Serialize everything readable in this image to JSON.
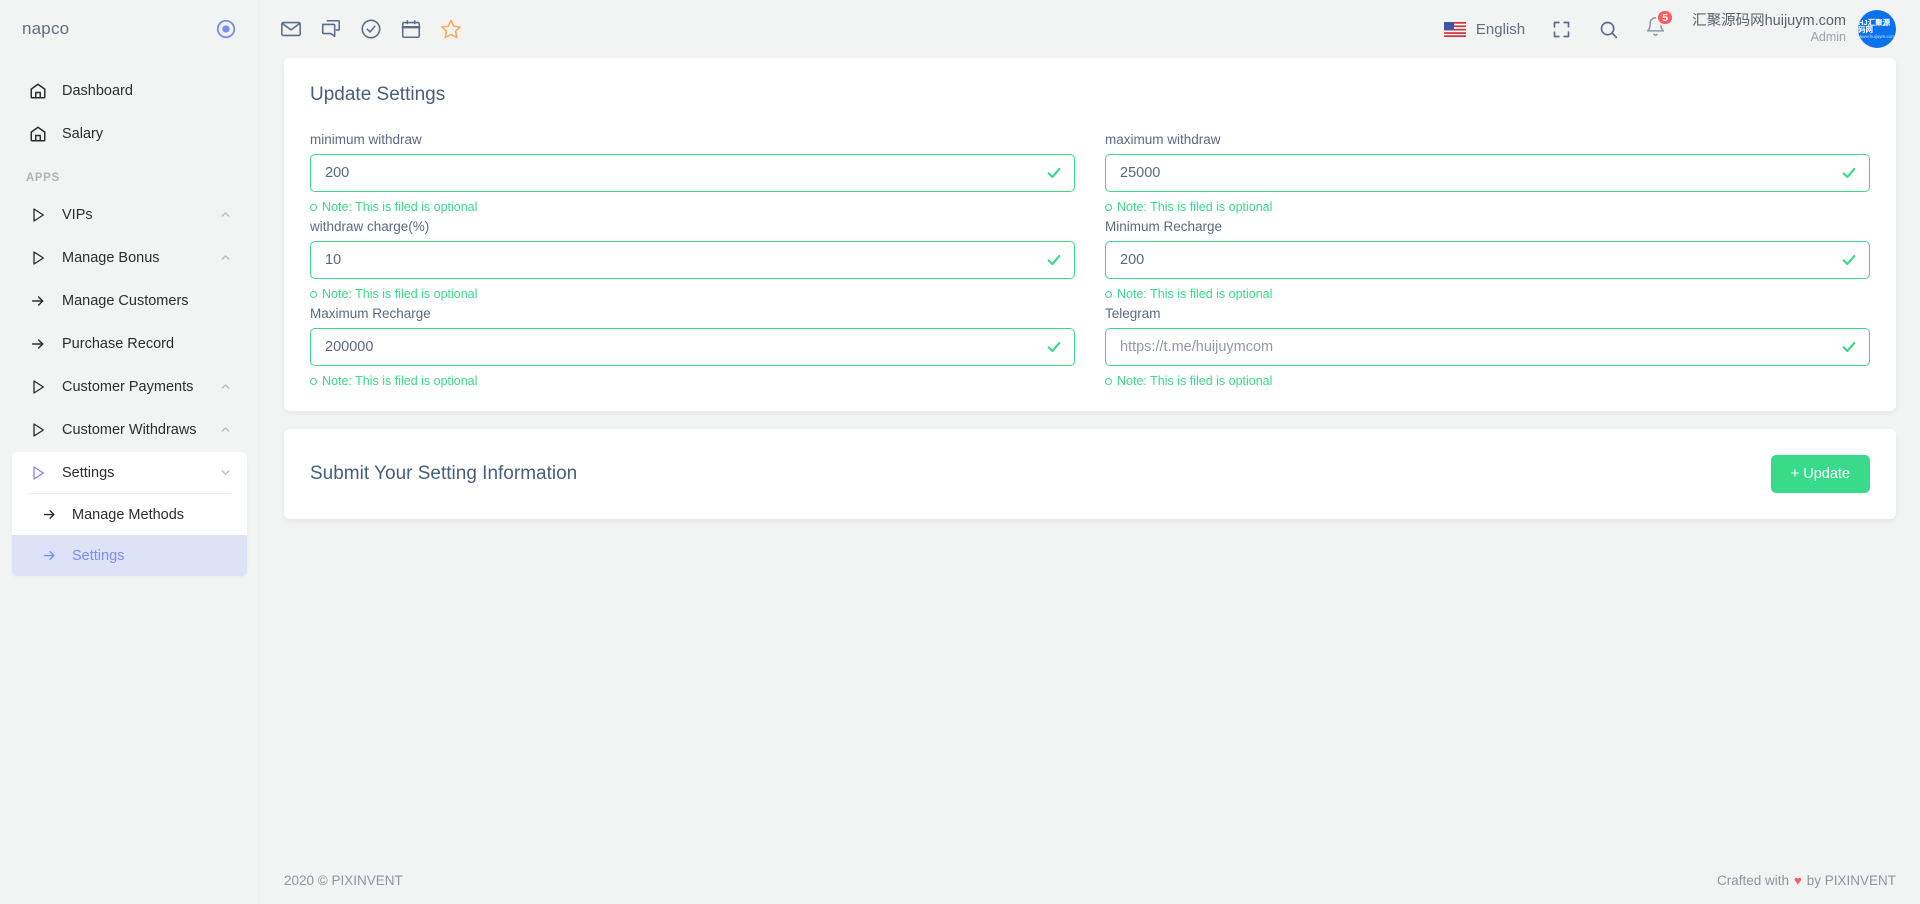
{
  "sidebar": {
    "brand": "napco",
    "pin_icon": "circle-dot-icon",
    "section_label": "APPS",
    "top_items": [
      {
        "label": "Dashboard",
        "icon": "home-icon",
        "expandable": false
      },
      {
        "label": "Salary",
        "icon": "home-icon",
        "expandable": false
      }
    ],
    "app_items": [
      {
        "label": "VIPs",
        "icon": "play-triangle-icon",
        "expandable": true,
        "chevron": "chevron-up-icon"
      },
      {
        "label": "Manage Bonus",
        "icon": "play-triangle-icon",
        "expandable": true,
        "chevron": "chevron-up-icon"
      },
      {
        "label": "Manage Customers",
        "icon": "arrow-right-icon",
        "expandable": false,
        "chevron": ""
      },
      {
        "label": "Purchase Record",
        "icon": "arrow-right-icon",
        "expandable": false,
        "chevron": ""
      },
      {
        "label": "Customer Payments",
        "icon": "play-triangle-icon",
        "expandable": true,
        "chevron": "chevron-up-icon"
      },
      {
        "label": "Customer Withdraws",
        "icon": "play-triangle-icon",
        "expandable": true,
        "chevron": "chevron-up-icon"
      }
    ],
    "settings_group": {
      "label": "Settings",
      "icon": "play-triangle-icon",
      "chevron": "chevron-down-icon",
      "children": [
        {
          "label": "Manage Methods",
          "icon": "arrow-right-icon",
          "active": false
        },
        {
          "label": "Settings",
          "icon": "arrow-right-icon",
          "active": true
        }
      ]
    }
  },
  "topbar": {
    "left_icons": [
      "mail-icon",
      "chat-icon",
      "check-circle-icon",
      "calendar-icon",
      "star-icon"
    ],
    "language": "English",
    "flag_icon": "us-flag-icon",
    "fullscreen_icon": "fullscreen-icon",
    "search_icon": "search-icon",
    "bell_icon": "bell-icon",
    "notification_count": "5",
    "user_name": "汇聚源码网huijuym.com",
    "user_role": "Admin",
    "avatar_text_primary": "HJ汇聚源码网",
    "avatar_text_secondary": "www.huijuym.com"
  },
  "main": {
    "card_title": "Update Settings",
    "note_text": "Note: This is filed is optional",
    "fields": [
      {
        "label": "minimum withdraw",
        "value": "200",
        "placeholder": "minimum withdraw",
        "is_placeholder": false,
        "column": "left"
      },
      {
        "label": "maximum withdraw",
        "value": "25000",
        "placeholder": "maximum withdraw",
        "is_placeholder": false,
        "column": "right"
      },
      {
        "label": "withdraw charge(%)",
        "value": "10",
        "placeholder": "withdraw charge",
        "is_placeholder": false,
        "column": "left"
      },
      {
        "label": "Minimum Recharge",
        "value": "200",
        "placeholder": "Minimum Recharge",
        "is_placeholder": false,
        "column": "right"
      },
      {
        "label": "Maximum Recharge",
        "value": "200000",
        "placeholder": "Maximum Recharge",
        "is_placeholder": false,
        "column": "left"
      },
      {
        "label": "Telegram",
        "value": "https://t.me/huijuymcom",
        "placeholder": "Telegram",
        "is_placeholder": true,
        "column": "right"
      }
    ],
    "submit_title": "Submit Your Setting Information",
    "update_button": "+ Update"
  },
  "footer": {
    "left": "2020 © PIXINVENT",
    "right_prefix": "Crafted with",
    "heart": "♥",
    "right_suffix": "by PIXINVENT"
  },
  "colors": {
    "accent_green": "#39da8a",
    "accent_blue": "#7b8df0",
    "badge_red": "#ff5b5c",
    "heading": "#475f7b",
    "avatar_blue": "#0b72ee"
  }
}
